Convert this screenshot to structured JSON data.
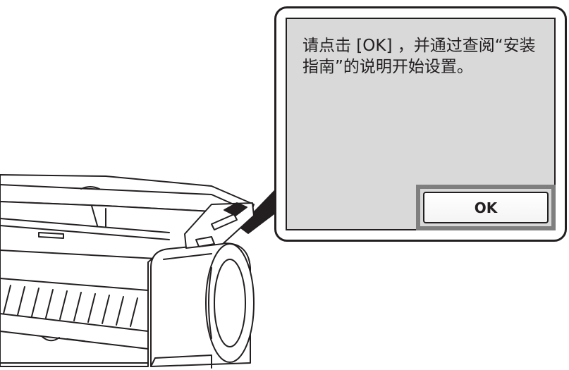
{
  "dialog": {
    "message": "请点击 [OK] ，并通过查阅“安装指南”的说明开始设置。",
    "ok_label": "OK"
  },
  "colors": {
    "screen_background": "#d9d9d9",
    "outline": "#231f20",
    "highlight_frame": "#7f7f7f"
  },
  "icons": [
    "large-format-printer-illustration"
  ]
}
